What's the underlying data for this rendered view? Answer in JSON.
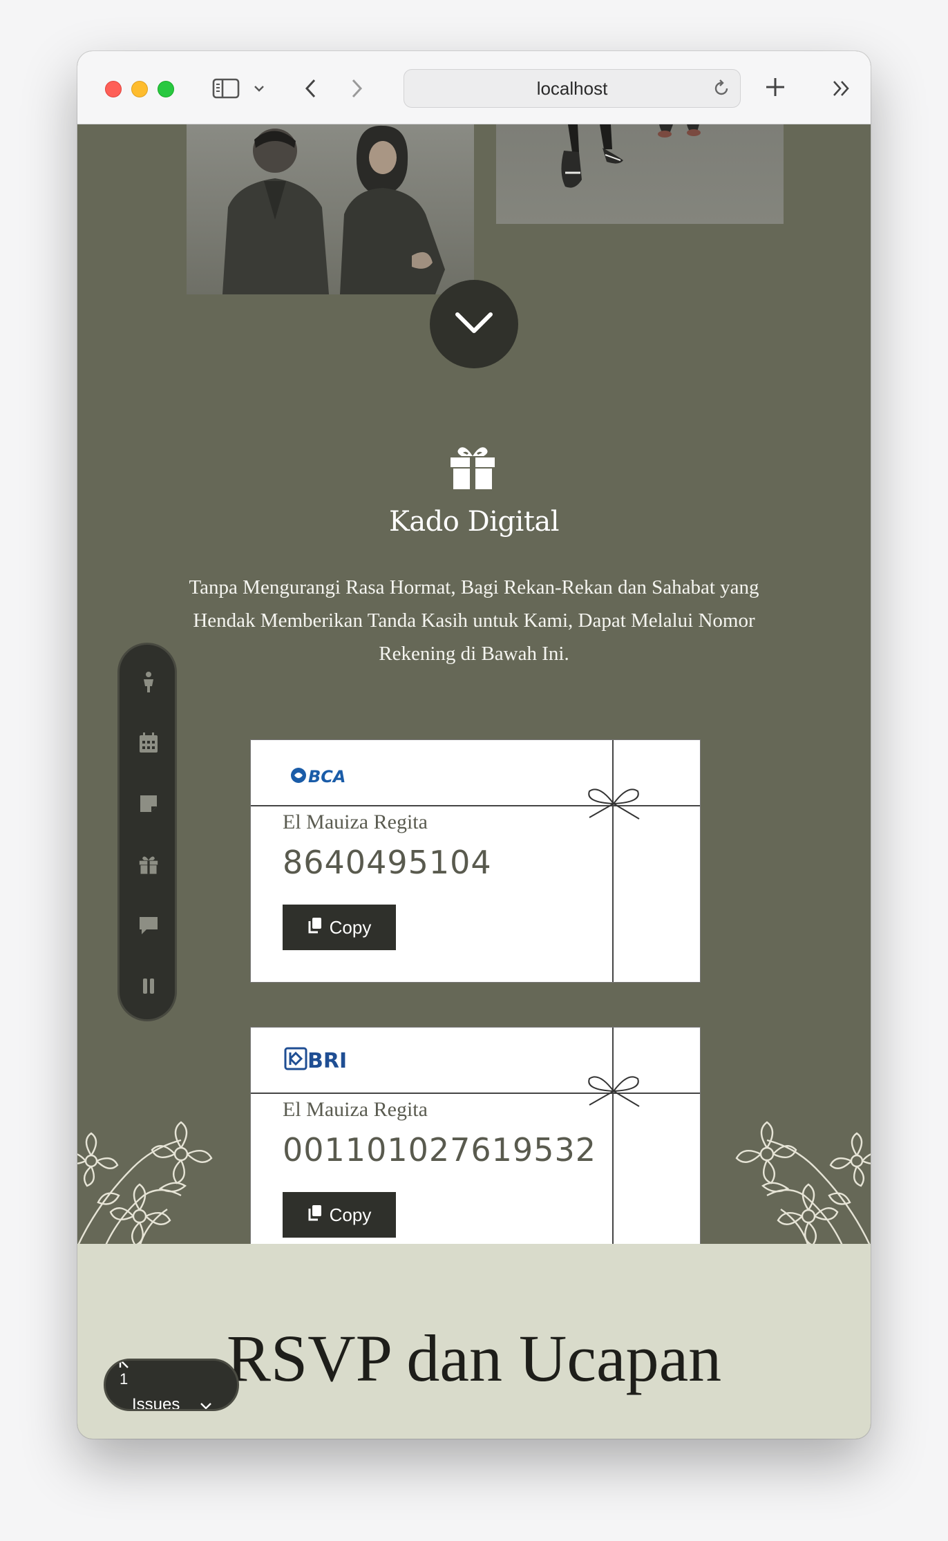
{
  "browser": {
    "address": "localhost"
  },
  "gift": {
    "title": "Kado Digital",
    "description": "Tanpa Mengurangi Rasa Hormat, Bagi Rekan-Rekan dan Sahabat yang Hendak Memberikan Tanda Kasih untuk Kami, Dapat Melalui Nomor Rekening di Bawah Ini."
  },
  "accounts": [
    {
      "bank": "BCA",
      "holder": "El Mauiza Regita",
      "number": "8640495104",
      "copy_label": "Copy",
      "color": "#1a5ca8"
    },
    {
      "bank": "BRI",
      "holder": "El Mauiza Regita",
      "number": "001101027619532",
      "copy_label": "Copy",
      "color": "#1f4e93"
    }
  ],
  "sidebar": {
    "items": [
      "couple-icon",
      "calendar-icon",
      "note-icon",
      "gift-icon",
      "chat-icon",
      "pause-icon"
    ]
  },
  "rsvp": {
    "title": "RSVP dan Ucapan"
  },
  "issues": {
    "count": "1",
    "label": "Issues"
  },
  "colors": {
    "green": "#666857",
    "dark": "#2f302b",
    "beige": "#d9dbcb"
  }
}
